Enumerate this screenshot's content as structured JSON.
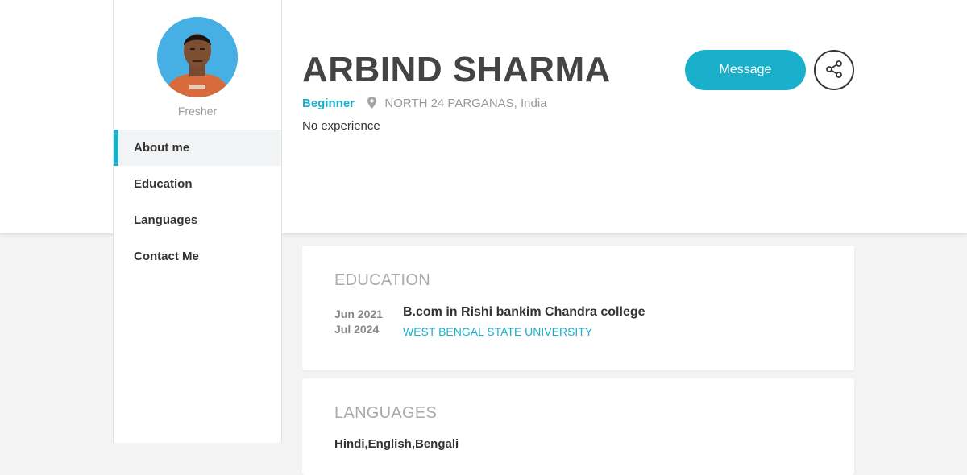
{
  "profile": {
    "name": "ARBIND SHARMA",
    "role": "Fresher",
    "level": "Beginner",
    "location": "NORTH 24 PARGANAS, India",
    "experience": "No experience"
  },
  "actions": {
    "message_label": "Message",
    "share_icon": "share-icon"
  },
  "sidebar": {
    "items": [
      {
        "label": "About me",
        "active": true
      },
      {
        "label": "Education",
        "active": false
      },
      {
        "label": "Languages",
        "active": false
      },
      {
        "label": "Contact Me",
        "active": false
      }
    ]
  },
  "education": {
    "title": "EDUCATION",
    "entries": [
      {
        "start": "Jun 2021",
        "end": "Jul 2024",
        "degree": "B.com in Rishi bankim Chandra college",
        "institution": "WEST BENGAL STATE UNIVERSITY"
      }
    ]
  },
  "languages": {
    "title": "LANGUAGES",
    "list": "Hindi,English,Bengali"
  },
  "colors": {
    "accent": "#1ab0cc",
    "page_background": "#f3f3f3",
    "card_background": "#ffffff"
  }
}
